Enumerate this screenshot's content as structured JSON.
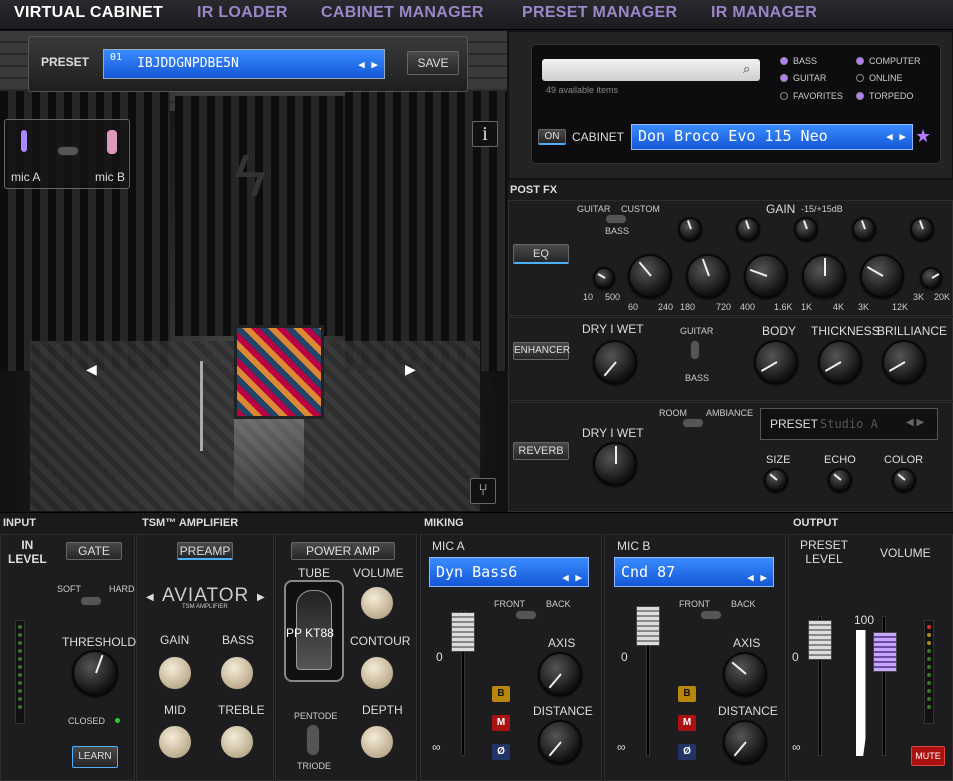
{
  "nav": {
    "tabs": [
      "VIRTUAL CABINET",
      "IR LOADER",
      "CABINET MANAGER",
      "PRESET MANAGER",
      "IR MANAGER"
    ]
  },
  "preset": {
    "label": "PRESET",
    "num": "01",
    "name": "IBJDDGNPDBE5N",
    "save": "SAVE"
  },
  "stage": {
    "mic_a": "mic A",
    "mic_b": "mic B",
    "info": "i"
  },
  "browser": {
    "available": "49 available items",
    "filters": [
      "BASS",
      "GUITAR",
      "FAVORITES",
      "COMPUTER",
      "ONLINE",
      "TORPEDO"
    ],
    "on": "ON",
    "cabinet_label": "CABINET",
    "cabinet_name": "Don Broco Evo 115 Neo"
  },
  "postfx": {
    "title": "POST FX",
    "eq": "EQ",
    "guitar": "GUITAR",
    "custom": "CUSTOM",
    "bass": "BASS",
    "gain": "GAIN",
    "gain_range": "-15/+15dB",
    "freqs": [
      "10",
      "500",
      "60",
      "240",
      "180",
      "720",
      "400",
      "1.6K",
      "1K",
      "4K",
      "3K",
      "12K",
      "3K",
      "20K"
    ],
    "enhancer": "ENHANCER",
    "dry_wet": "DRY  I  WET",
    "body": "BODY",
    "thickness": "THICKNESS",
    "brilliance": "BRILLIANCE",
    "reverb": "REVERB",
    "room": "ROOM",
    "ambiance": "AMBIANCE",
    "preset": "PRESET",
    "reverb_preset": "Studio A",
    "size": "SIZE",
    "echo": "ECHO",
    "color": "COLOR"
  },
  "input": {
    "title": "INPUT",
    "in_level": "IN\nLEVEL",
    "gate": "GATE",
    "soft": "SOFT",
    "hard": "HARD",
    "threshold": "THRESHOLD",
    "closed": "CLOSED",
    "learn": "LEARN"
  },
  "amp": {
    "title": "TSM™ AMPLIFIER",
    "preamp": "PREAMP",
    "poweramp": "POWER AMP",
    "model": "AVIATOR",
    "model_sub": "TSM AMPLIFIER",
    "gain": "GAIN",
    "bass": "BASS",
    "mid": "MID",
    "treble": "TREBLE",
    "tube": "TUBE",
    "tube_name": "PP KT88",
    "volume": "VOLUME",
    "contour": "CONTOUR",
    "depth": "DEPTH",
    "pentode": "PENTODE",
    "triode": "TRIODE"
  },
  "miking": {
    "title": "MIKING",
    "mic_a": "MIC A",
    "mic_a_model": "Dyn Bass6",
    "mic_b": "MIC B",
    "mic_b_model": "Cnd 87",
    "front": "FRONT",
    "back": "BACK",
    "axis": "AXIS",
    "distance": "DISTANCE",
    "zero": "0",
    "inf": "∞",
    "b": "B",
    "m": "M",
    "phase": "Ø"
  },
  "output": {
    "title": "OUTPUT",
    "preset_level": "PRESET\nLEVEL",
    "volume": "VOLUME",
    "hundred": "100",
    "zero": "0",
    "inf": "∞",
    "mute": "MUTE"
  },
  "colors": {
    "accent_purple": "#b57cff",
    "lcd_blue": "#1f6cf0",
    "nav_active": "#ffffff",
    "nav_inactive": "#9a86c8"
  }
}
